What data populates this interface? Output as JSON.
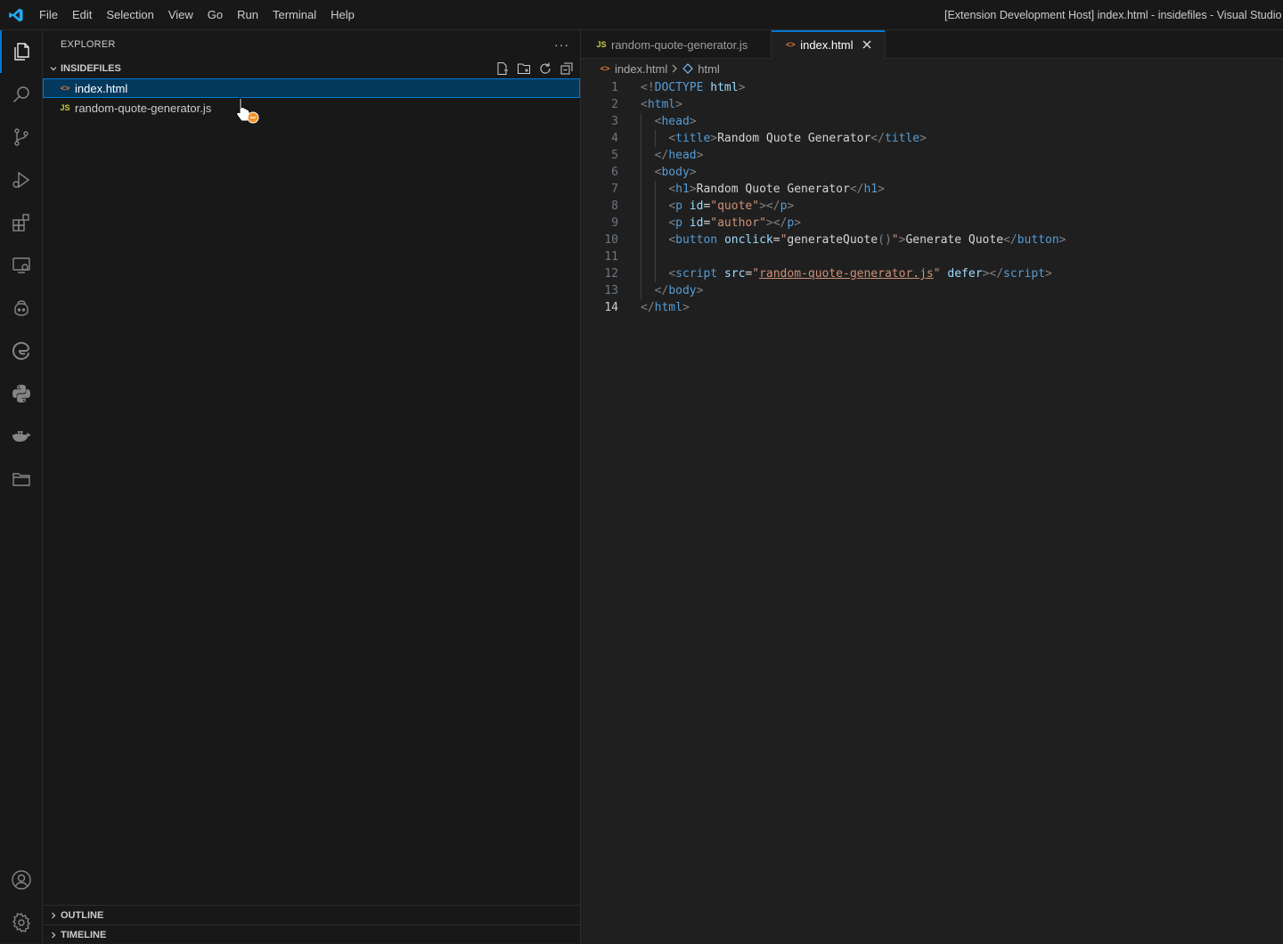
{
  "window": {
    "title": "[Extension Development Host] index.html - insidefiles - Visual Studio Code"
  },
  "menu": [
    "File",
    "Edit",
    "Selection",
    "View",
    "Go",
    "Run",
    "Terminal",
    "Help"
  ],
  "activity_bar": {
    "items": [
      "explorer-icon",
      "search-icon",
      "source-control-icon",
      "run-debug-icon",
      "extensions-icon",
      "remote-explorer-icon",
      "copilot-icon",
      "edge-tools-icon",
      "python-icon",
      "docker-icon",
      "project-manager-icon"
    ],
    "bottom": [
      "account-icon",
      "settings-gear-icon"
    ],
    "accent": "#0078d4"
  },
  "sidebar": {
    "title": "EXPLORER",
    "more": "···",
    "folder": "INSIDEFILES",
    "files": [
      {
        "name": "index.html",
        "icon": "<>",
        "type": "html",
        "selected": true
      },
      {
        "name": "random-quote-generator.js",
        "icon": "JS",
        "type": "js",
        "selected": false
      }
    ],
    "outline": "OUTLINE",
    "timeline": "TIMELINE"
  },
  "tabs": [
    {
      "label": "random-quote-generator.js",
      "icon": "JS",
      "active": false
    },
    {
      "label": "index.html",
      "icon": "<>",
      "active": true
    }
  ],
  "breadcrumb": {
    "file": "index.html",
    "symbol": "html"
  },
  "editor": {
    "current_line": 14,
    "lines": [
      {
        "n": "1",
        "tokens": [
          [
            "p",
            "<!"
          ],
          [
            "t",
            "DOCTYPE"
          ],
          [
            "x",
            " "
          ],
          [
            "a",
            "html"
          ],
          [
            "p",
            ">"
          ]
        ]
      },
      {
        "n": "2",
        "tokens": [
          [
            "p",
            "<"
          ],
          [
            "t",
            "html"
          ],
          [
            "p",
            ">"
          ]
        ]
      },
      {
        "n": "3",
        "tokens": [
          [
            "x",
            "  "
          ],
          [
            "p",
            "<"
          ],
          [
            "t",
            "head"
          ],
          [
            "p",
            ">"
          ]
        ]
      },
      {
        "n": "4",
        "tokens": [
          [
            "x",
            "    "
          ],
          [
            "p",
            "<"
          ],
          [
            "t",
            "title"
          ],
          [
            "p",
            ">"
          ],
          [
            "x",
            "Random Quote Generator"
          ],
          [
            "p",
            "</"
          ],
          [
            "t",
            "title"
          ],
          [
            "p",
            ">"
          ]
        ]
      },
      {
        "n": "5",
        "tokens": [
          [
            "x",
            "  "
          ],
          [
            "p",
            "</"
          ],
          [
            "t",
            "head"
          ],
          [
            "p",
            ">"
          ]
        ]
      },
      {
        "n": "6",
        "tokens": [
          [
            "x",
            "  "
          ],
          [
            "p",
            "<"
          ],
          [
            "t",
            "body"
          ],
          [
            "p",
            ">"
          ]
        ]
      },
      {
        "n": "7",
        "tokens": [
          [
            "x",
            "    "
          ],
          [
            "p",
            "<"
          ],
          [
            "t",
            "h1"
          ],
          [
            "p",
            ">"
          ],
          [
            "x",
            "Random Quote Generator"
          ],
          [
            "p",
            "</"
          ],
          [
            "t",
            "h1"
          ],
          [
            "p",
            ">"
          ]
        ]
      },
      {
        "n": "8",
        "tokens": [
          [
            "x",
            "    "
          ],
          [
            "p",
            "<"
          ],
          [
            "t",
            "p"
          ],
          [
            "x",
            " "
          ],
          [
            "a",
            "id"
          ],
          [
            "x",
            "="
          ],
          [
            "s",
            "\"quote\""
          ],
          [
            "p",
            "></"
          ],
          [
            "t",
            "p"
          ],
          [
            "p",
            ">"
          ]
        ]
      },
      {
        "n": "9",
        "tokens": [
          [
            "x",
            "    "
          ],
          [
            "p",
            "<"
          ],
          [
            "t",
            "p"
          ],
          [
            "x",
            " "
          ],
          [
            "a",
            "id"
          ],
          [
            "x",
            "="
          ],
          [
            "s",
            "\"author\""
          ],
          [
            "p",
            "></"
          ],
          [
            "t",
            "p"
          ],
          [
            "p",
            ">"
          ]
        ]
      },
      {
        "n": "10",
        "tokens": [
          [
            "x",
            "    "
          ],
          [
            "p",
            "<"
          ],
          [
            "t",
            "button"
          ],
          [
            "x",
            " "
          ],
          [
            "a",
            "onclick"
          ],
          [
            "x",
            "="
          ],
          [
            "s",
            "\""
          ],
          [
            "x",
            "generateQuote"
          ],
          [
            "p",
            "()"
          ],
          [
            "s",
            "\""
          ],
          [
            "p",
            ">"
          ],
          [
            "x",
            "Generate Quote"
          ],
          [
            "p",
            "</"
          ],
          [
            "t",
            "button"
          ],
          [
            "p",
            ">"
          ]
        ]
      },
      {
        "n": "11",
        "tokens": []
      },
      {
        "n": "12",
        "tokens": [
          [
            "x",
            "    "
          ],
          [
            "p",
            "<"
          ],
          [
            "t",
            "script"
          ],
          [
            "x",
            " "
          ],
          [
            "a",
            "src"
          ],
          [
            "x",
            "="
          ],
          [
            "s",
            "\""
          ],
          [
            "l",
            "random-quote-generator.js"
          ],
          [
            "s",
            "\""
          ],
          [
            "x",
            " "
          ],
          [
            "a",
            "defer"
          ],
          [
            "p",
            "></"
          ],
          [
            "t",
            "script"
          ],
          [
            "p",
            ">"
          ]
        ]
      },
      {
        "n": "13",
        "tokens": [
          [
            "x",
            "  "
          ],
          [
            "p",
            "</"
          ],
          [
            "t",
            "body"
          ],
          [
            "p",
            ">"
          ]
        ]
      },
      {
        "n": "14",
        "tokens": [
          [
            "p",
            "</"
          ],
          [
            "t",
            "html"
          ],
          [
            "p",
            ">"
          ]
        ]
      }
    ]
  }
}
